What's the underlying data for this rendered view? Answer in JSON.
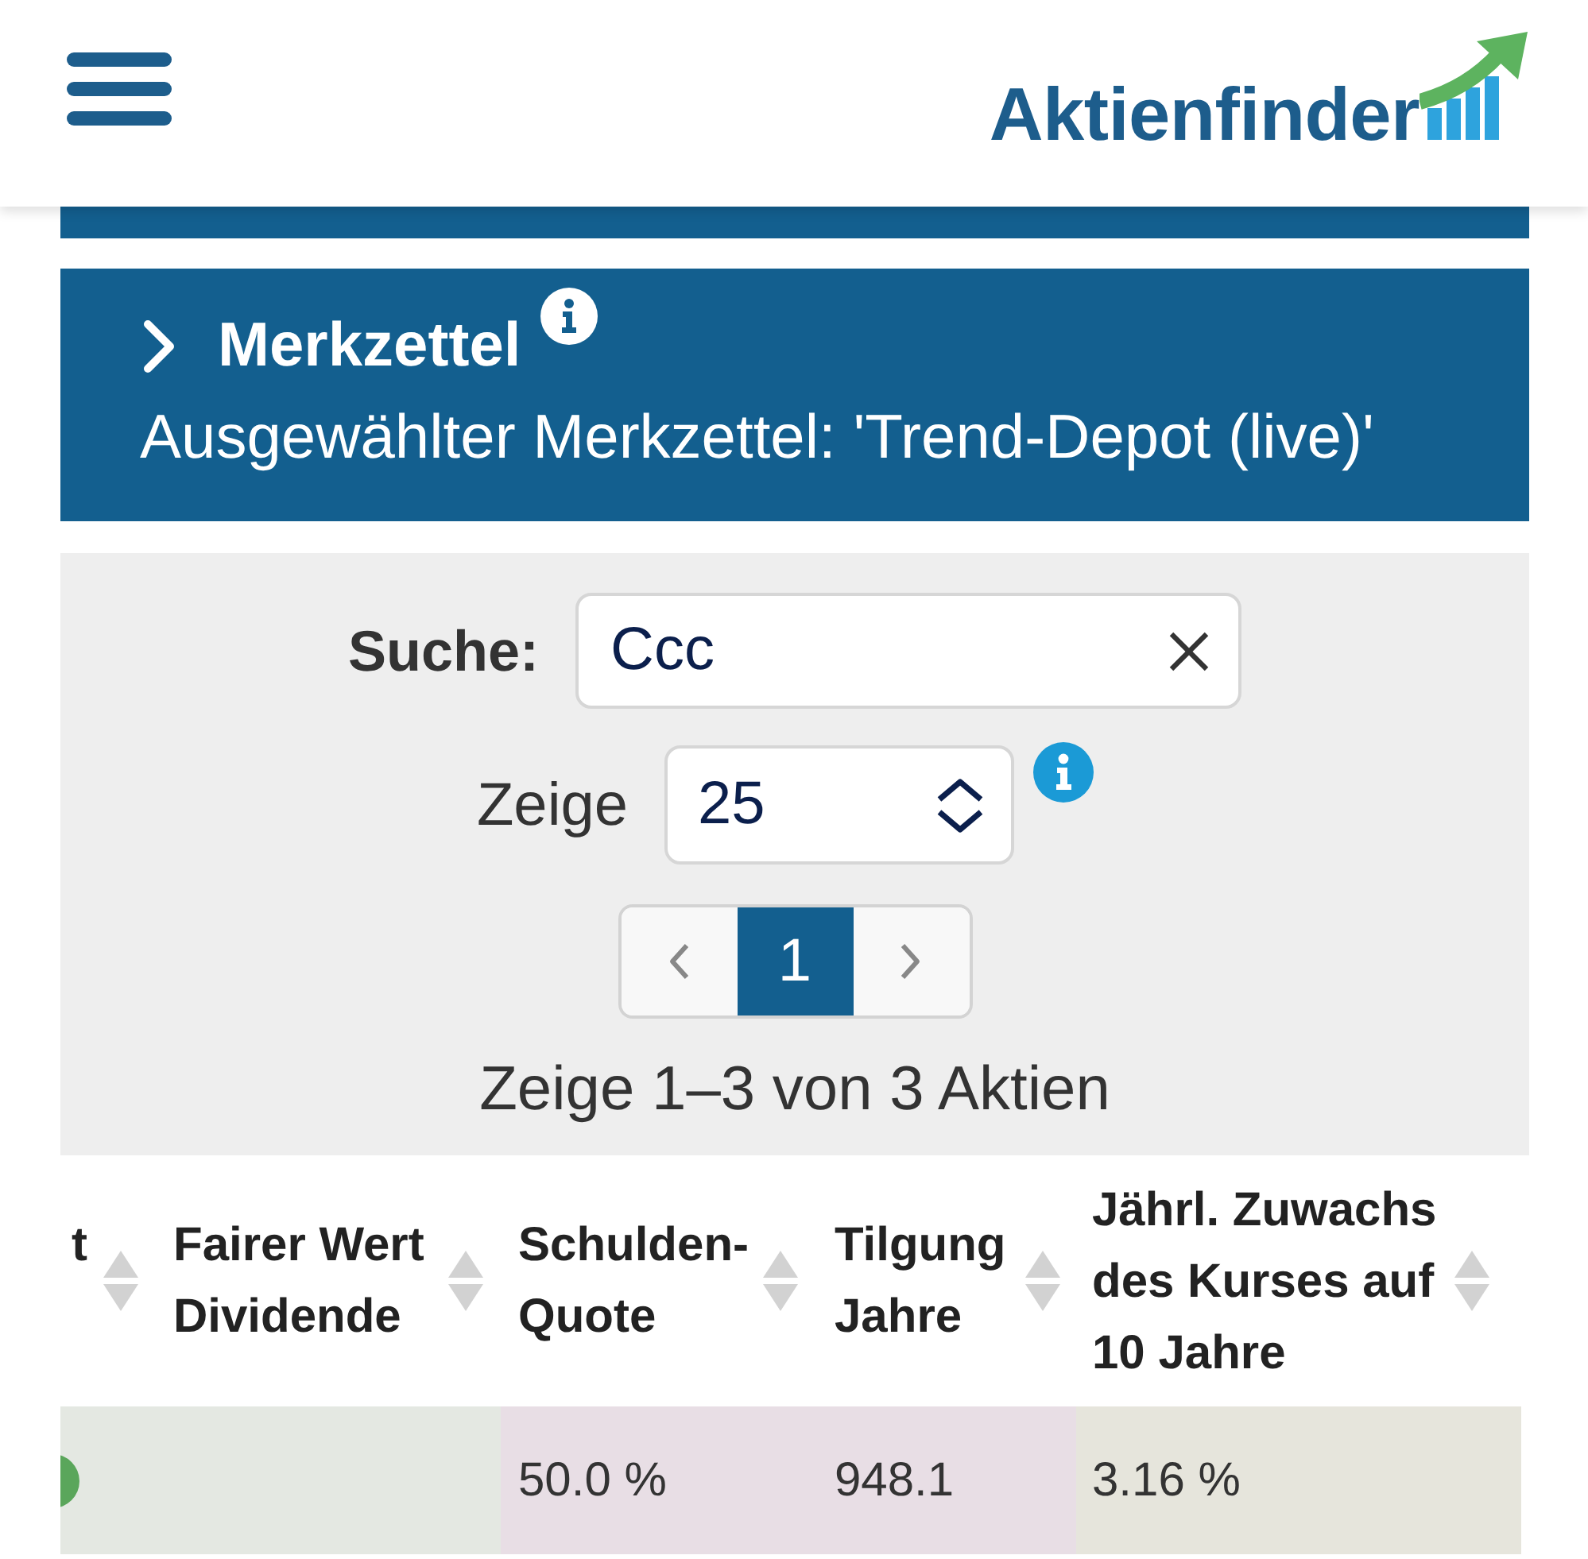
{
  "header": {
    "logo_text": "Aktienfinder"
  },
  "watchlist_panel": {
    "title": "Merkzettel",
    "expanded": false,
    "subtitle": "Ausgewählter Merkzettel: 'Trend-Depot (live)'"
  },
  "filters": {
    "search": {
      "label": "Suche:",
      "value": "Ccc"
    },
    "page_size": {
      "label": "Zeige",
      "value": "25"
    },
    "pagination": {
      "pages": [
        {
          "label": "1",
          "selected": true
        }
      ]
    },
    "summary": "Zeige 1–3 von 3 Aktien"
  },
  "table": {
    "columns": [
      {
        "label": "t"
      },
      {
        "label": "Fairer Wert Dividende"
      },
      {
        "label": "Schulden-Quote"
      },
      {
        "label": "Tilgung Jahre"
      },
      {
        "label": "Jährl. Zuwachs des Kurses auf 10 Jahre"
      }
    ],
    "rows": [
      {
        "cells": [
          {
            "kind": "dot",
            "color": "#e4e8e2",
            "dot": {
              "color": "#5aa65b"
            }
          },
          {
            "kind": "blank",
            "color": "#e4e8e2"
          },
          {
            "kind": "text",
            "text": "50.0 %",
            "color": "#e8dee5"
          },
          {
            "kind": "text",
            "text": "948.1",
            "color": "#e8dee5"
          },
          {
            "kind": "text",
            "text": "3.16 %",
            "color": "#e6e5dc"
          }
        ]
      }
    ]
  }
}
